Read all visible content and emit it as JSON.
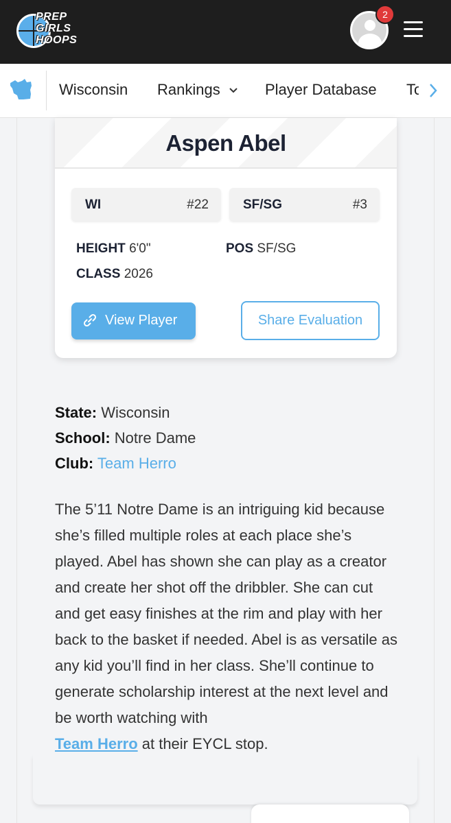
{
  "header": {
    "logo_lines": [
      "PREP",
      "GIRLS",
      "HOOPS"
    ],
    "notification_count": "2",
    "colors": {
      "background": "#1e1e1e",
      "badge": "#e03a3a",
      "accent": "#59aee8"
    }
  },
  "nav": {
    "state_icon": "wisconsin-map-icon",
    "items": [
      "Wisconsin",
      "Rankings",
      "Player Database",
      "To"
    ],
    "rankings_dropdown_icon": "chevron-down-icon",
    "scroll_icon": "chevron-right-icon"
  },
  "player": {
    "name": "Aspen Abel",
    "state_rank": {
      "label": "WI",
      "value": "#22"
    },
    "position_rank": {
      "label": "SF/SG",
      "value": "#3"
    },
    "height_label": "HEIGHT",
    "height": "6'0\"",
    "pos_label": "POS",
    "pos": "SF/SG",
    "class_label": "CLASS",
    "class": "2026",
    "view_button": "View Player",
    "share_button": "Share Evaluation"
  },
  "article": {
    "state_label": "State:",
    "state": "Wisconsin",
    "school_label": "School:",
    "school": "Notre Dame",
    "club_label": "Club:",
    "club": "Team Herro",
    "bio_text": "The 5’11 Notre Dame is an intriguing kid because she’s filled multiple roles at each place she’s played. Abel has shown she can play as a creator and create her shot off the dribbler. She can cut and get easy finishes at the rim and play with her back to the basket if needed. Abel is as versatile as any kid you’ll find in her class. She’ll continue to generate scholarship interest at the next level and be worth watching with",
    "bio_link": "Team Herro",
    "bio_end": " at their EYCL stop."
  }
}
